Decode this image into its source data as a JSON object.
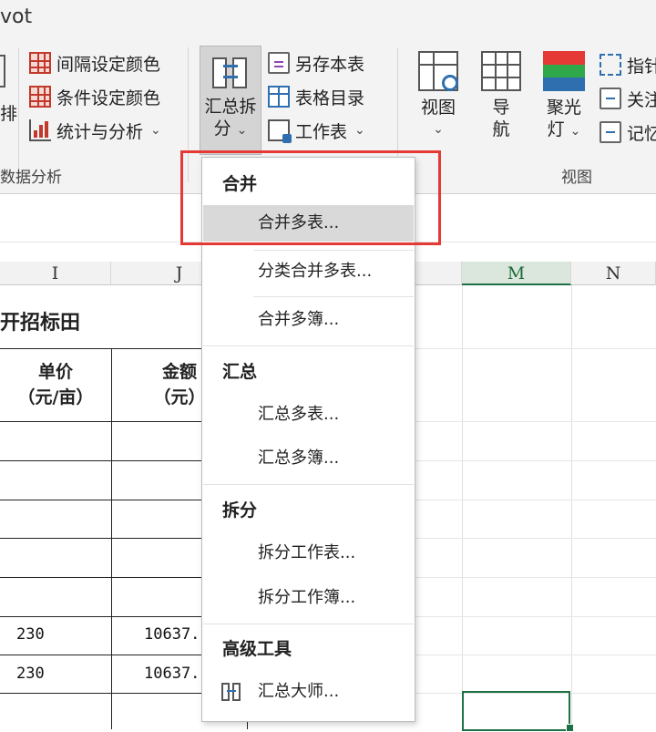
{
  "ribbon": {
    "tab_fragment": "vot",
    "left_fragment": "排",
    "group_left_label": "数据分析",
    "col1": {
      "interval_color": "间隔设定颜色",
      "conditional_color": "条件设定颜色",
      "stats_analysis": "统计与分析"
    },
    "summarize_split": {
      "line1": "汇总拆",
      "line2": "分"
    },
    "col2": {
      "save_sheet": "另存本表",
      "table_directory": "表格目录",
      "worksheet": "工作表"
    },
    "view": {
      "label": "视图"
    },
    "navigate": {
      "line1": "导",
      "line2": "航"
    },
    "spotlight": {
      "line1": "聚光",
      "line2": "灯"
    },
    "col3": {
      "pointer": "指针",
      "focus": "关注",
      "memo": "记忆"
    },
    "group_view_label": "视图",
    "chevron": "⌄"
  },
  "sheet": {
    "columns": [
      "I",
      "J",
      "M",
      "N"
    ],
    "title": "开招标田",
    "header_unit_price": {
      "line1": "单价",
      "line2": "（元/亩）"
    },
    "header_amount": {
      "line1": "金额",
      "line2": "（元）"
    },
    "rows": [
      {
        "price": "230",
        "amount": "10637."
      },
      {
        "price": "230",
        "amount": "10637."
      }
    ]
  },
  "menu": {
    "section_merge": "合并",
    "merge_sheets": "合并多表...",
    "merge_sheets_by_category": "分类合并多表...",
    "merge_workbooks": "合并多簿...",
    "section_summary": "汇总",
    "summary_sheets": "汇总多表...",
    "summary_workbooks": "汇总多簿...",
    "section_split": "拆分",
    "split_worksheet": "拆分工作表...",
    "split_workbook": "拆分工作簿...",
    "section_advanced": "高级工具",
    "summary_master": "汇总大师..."
  },
  "colors": {
    "highlight_box": "#e53935",
    "selection": "#1e7145",
    "menu_highlight": "#d9d9d9"
  }
}
